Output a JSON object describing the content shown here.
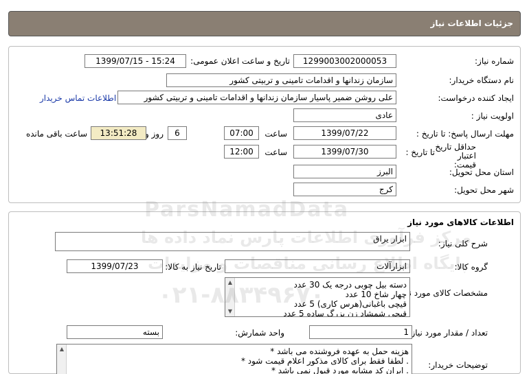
{
  "header": {
    "title": "جزئیات اطلاعات نیاز"
  },
  "details": {
    "need_number_label": "شماره نیاز:",
    "need_number": "1299003002000053",
    "announce_label": "تاریخ و ساعت اعلان عمومی:",
    "announce_value": "1399/07/15 - 15:24",
    "buyer_org_label": "نام دستگاه خریدار:",
    "buyer_org": "سازمان زندانها و اقدامات تامینی و تربیتی کشور",
    "requester_label": "ایجاد کننده درخواست:",
    "requester": "علی روشن ضمیر پاسیار سازمان زندانها و اقدامات تامینی و تربیتی کشور",
    "contact_link": "اطلاعات تماس خریدار",
    "priority_label": "اولویت نیاز :",
    "priority": "عادی",
    "deadline_label": "مهلت ارسال پاسخ: تا تاریخ :",
    "deadline_date": "1399/07/22",
    "time_label": "ساعت",
    "deadline_time": "07:00",
    "days_value": "6",
    "days_label": "روز و",
    "remaining_time": "13:51:28",
    "remaining_label": "ساعت باقی مانده",
    "validity_label": "حداقل تاریخ اعتبار قیمت:",
    "validity_to_label": "تا تاریخ :",
    "validity_date": "1399/07/30",
    "validity_time": "12:00",
    "province_label": "استان محل تحویل:",
    "province": "البرز",
    "city_label": "شهر محل تحویل:",
    "city": "کرج"
  },
  "goods": {
    "section_title": "اطلاعات کالاهای مورد نیاز",
    "desc_label": "شرح کلی نیاز:",
    "desc": "ابزار یراق",
    "group_label": "گروه کالا:",
    "group": "ابزارآلات",
    "need_date_label": "تاریخ نیاز به کالا:",
    "need_date": "1399/07/23",
    "specs_label": "مشخصات کالای مورد نیاز:",
    "specs": [
      "دسته بیل چوبی درجه یک 30 عدد",
      "چهار شاخ  10 عدد",
      "قیچی باغبانی(هرس کاری) 5 عدد",
      "قیچی شمشاد زن بزرگ ساده 5 عدد"
    ],
    "qty_label": "تعداد / مقدار مورد نیاز:",
    "qty": "1",
    "unit_label": "واحد شمارش:",
    "unit": "بسته",
    "notes_label": "توضیحات خریدار:",
    "notes": [
      "هزینه حمل به عهده فروشنده می باشد *",
      ". لطفا فقط برای کالای مذکور اعلام قیمت شود *",
      ". ایران کد مشابه مورد قبول نمی باشد *"
    ]
  },
  "watermark": {
    "brand": "ParsNamadData",
    "line1": "مرکز فرآوری اطلاعات پارس نماد داده ها",
    "line2": "پایگاه اطلاع رسانی مناقصات و مزایدات",
    "phone": "۰۲۱-۸۸۳۴۹۶۷۰"
  }
}
